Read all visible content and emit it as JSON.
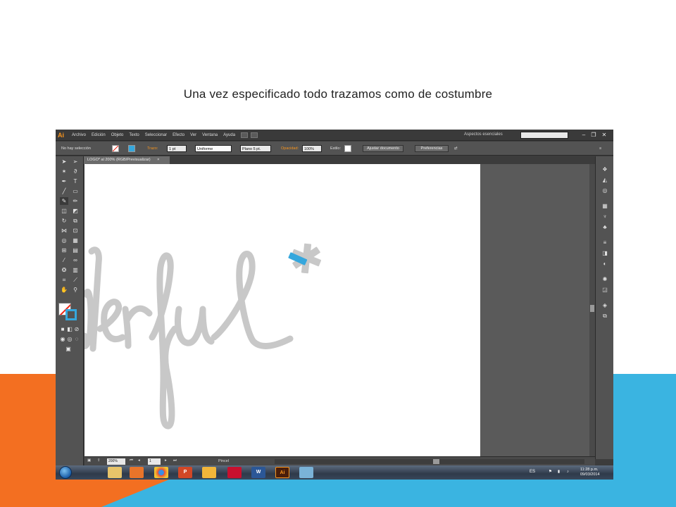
{
  "slide": {
    "title": "Una vez especificado todo trazamos como de costumbre",
    "colors": {
      "accent_orange": "#f36f21",
      "accent_blue": "#3ab4e1"
    }
  },
  "app": {
    "logo": "Ai",
    "menu": [
      "Archivo",
      "Edición",
      "Objeto",
      "Texto",
      "Seleccionar",
      "Efecto",
      "Ver",
      "Ventana",
      "Ayuda"
    ],
    "workspace": "Aspectos esenciales",
    "window_controls": [
      "–",
      "❐",
      "✕"
    ]
  },
  "control_bar": {
    "selection_status": "No hay selección",
    "stroke_label": "Trazo:",
    "stroke_weight": "1 pt",
    "stroke_profile": "Uniforme",
    "brush": "Plano 5 pt.",
    "opacity_label": "Opacidad:",
    "opacity_value": "100%",
    "style_label": "Estilo:",
    "align_document_button": "Ajustar documento",
    "preferences_button": "Preferencias"
  },
  "document": {
    "tab_label": "LOGO* al 200% (RGB/Previsualizar)",
    "tab_close": "×",
    "artwork_text": "derful",
    "artwork_colors": {
      "script": "#c8c8c8",
      "asterisk": "#35a7dd"
    }
  },
  "status_bar": {
    "zoom": "200%",
    "page": "1",
    "current_tool": "Pincel"
  },
  "taskbar": {
    "apps": [
      {
        "icon": "explorer-icon",
        "label": ""
      },
      {
        "icon": "media-player-icon",
        "label": ""
      },
      {
        "icon": "chrome-icon",
        "label": ""
      },
      {
        "icon": "powerpoint-icon",
        "label": "P"
      },
      {
        "icon": "paint-icon",
        "label": ""
      },
      {
        "icon": "acrobat-icon",
        "label": ""
      },
      {
        "icon": "word-icon",
        "label": "W"
      },
      {
        "icon": "illustrator-icon",
        "label": "Ai"
      },
      {
        "icon": "palette-icon",
        "label": ""
      }
    ],
    "language": "ES",
    "time": "11:28 p.m.",
    "date": "09/03/2014"
  }
}
